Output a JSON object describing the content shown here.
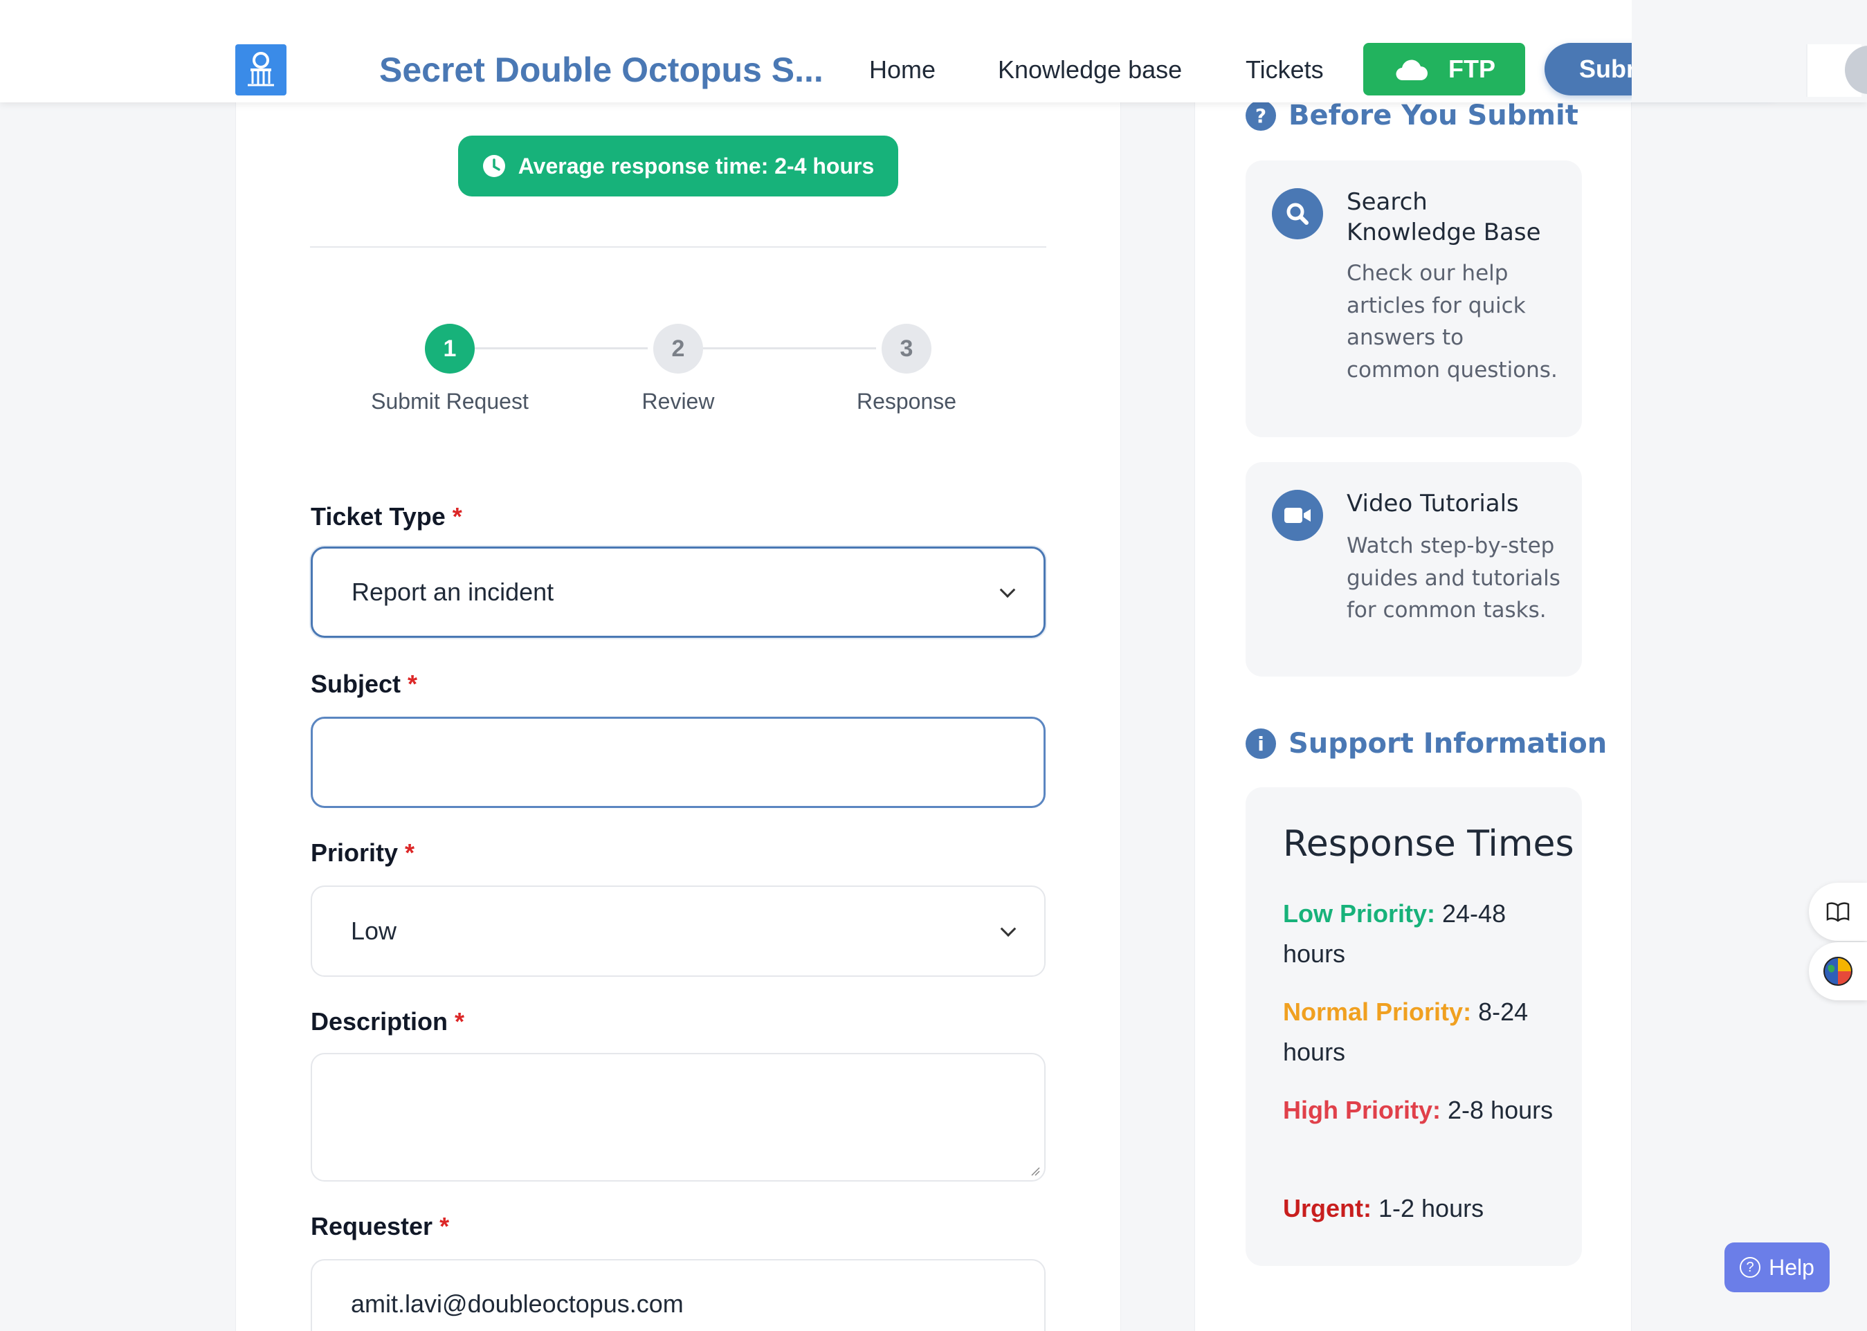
{
  "header": {
    "brand": "Secret Double Octopus S...",
    "nav": [
      "Home",
      "Knowledge base",
      "Tickets"
    ],
    "ftp_label": "FTP",
    "submit_label": "Submit a ticket"
  },
  "form": {
    "response_time": "Average response time: 2-4 hours",
    "steps": [
      {
        "number": "1",
        "label": "Submit Request",
        "active": true
      },
      {
        "number": "2",
        "label": "Review",
        "active": false
      },
      {
        "number": "3",
        "label": "Response",
        "active": false
      }
    ],
    "required_mark": "*",
    "ticket_type": {
      "label": "Ticket Type",
      "value": "Report an incident"
    },
    "subject": {
      "label": "Subject",
      "value": ""
    },
    "priority": {
      "label": "Priority",
      "value": "Low"
    },
    "description": {
      "label": "Description",
      "value": ""
    },
    "requester": {
      "label": "Requester",
      "value": "amit.lavi@doubleoctopus.com"
    }
  },
  "sidebar": {
    "before_heading": "Before You Submit",
    "tips": [
      {
        "icon": "search-icon",
        "title": "Search Knowledge Base",
        "desc": "Check our help articles for quick answers to common questions."
      },
      {
        "icon": "video-icon",
        "title": "Video Tutorials",
        "desc": "Watch step-by-step guides and tutorials for common tasks."
      }
    ],
    "support_heading": "Support Information",
    "response_times": {
      "title": "Response Times",
      "rows": [
        {
          "level": "Low Priority:",
          "time": "24-48 hours",
          "color": "#17b27a"
        },
        {
          "level": "Normal Priority:",
          "time": "8-24 hours",
          "color": "#f0a020"
        },
        {
          "level": "High Priority:",
          "time": "2-8 hours",
          "color": "#e0404a"
        },
        {
          "level": "Urgent:",
          "time": "1-2 hours",
          "color": "#c81e1e"
        }
      ]
    }
  },
  "help_label": "Help",
  "colors": {
    "brand": "#4a78b4",
    "success": "#17b27a",
    "ftp": "#22b35e"
  }
}
